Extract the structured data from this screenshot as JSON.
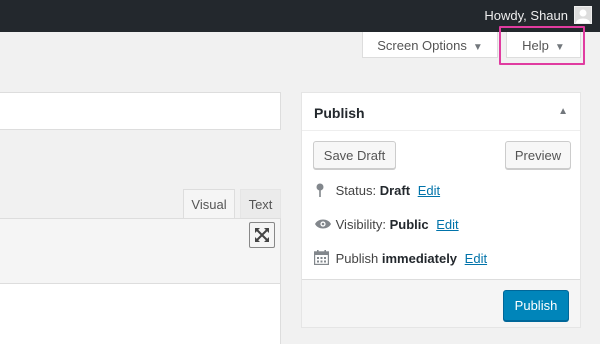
{
  "adminbar": {
    "greeting": "Howdy, Shaun",
    "avatar_icon": "user-avatar-icon"
  },
  "screen_meta": {
    "screen_options_label": "Screen Options",
    "help_label": "Help",
    "arrow_icon": "triangle-down-icon",
    "highlight_color": "#e03ca0"
  },
  "editor": {
    "tabs": [
      "Visual",
      "Text"
    ],
    "fullscreen_icon": "fullscreen-expand-icon"
  },
  "publish_box": {
    "title": "Publish",
    "collapse_icon": "triangle-up-icon",
    "save_draft_label": "Save Draft",
    "preview_label": "Preview",
    "status_label": "Status:",
    "status_value": "Draft",
    "visibility_label": "Visibility:",
    "visibility_value": "Public",
    "publish_label": "Publish",
    "publish_value": "immediately",
    "edit_link": "Edit",
    "publish_button_label": "Publish",
    "accent_color": "#0085ba"
  }
}
